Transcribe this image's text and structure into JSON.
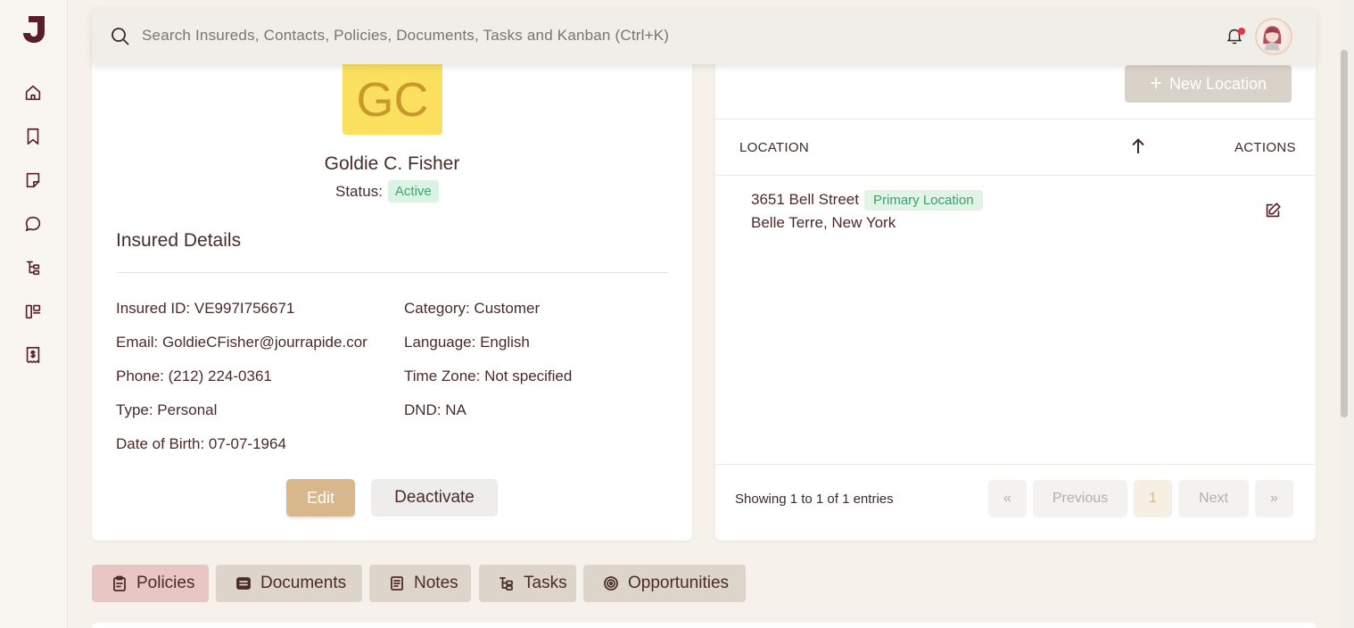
{
  "search": {
    "placeholder": "Search Insureds, Contacts, Policies, Documents, Tasks and Kanban (Ctrl+K)"
  },
  "sidebar": {
    "items": [
      {
        "name": "home-icon"
      },
      {
        "name": "bookmark-icon"
      },
      {
        "name": "note-icon"
      },
      {
        "name": "chat-icon"
      },
      {
        "name": "tasks-icon"
      },
      {
        "name": "kanban-icon"
      },
      {
        "name": "receipt-icon"
      }
    ]
  },
  "insured": {
    "initials": "GC",
    "name": "Goldie C. Fisher",
    "status_label": "Status:",
    "status": "Active",
    "section_title": "Insured Details",
    "details_left": [
      "Insured ID: VE997I756671",
      "Email: GoldieCFisher@jourrapide.cor",
      "Phone: (212) 224-0361",
      "Type: Personal",
      "Date of Birth: 07-07-1964"
    ],
    "details_right": [
      "Category: Customer",
      "Language: English",
      "Time Zone: Not specified",
      "DND: NA"
    ],
    "edit_label": "Edit",
    "deactivate_label": "Deactivate"
  },
  "locations": {
    "new_label": "New Location",
    "col_location": "LOCATION",
    "col_actions": "ACTIONS",
    "rows": [
      {
        "street": "3651 Bell Street",
        "badge": "Primary Location",
        "city": "Belle Terre, New York"
      }
    ],
    "showing": "Showing 1 to 1 of 1 entries",
    "first": "«",
    "previous": "Previous",
    "page": "1",
    "next": "Next",
    "last": "»"
  },
  "tabs": [
    {
      "label": "Policies",
      "active": true
    },
    {
      "label": "Documents",
      "active": false
    },
    {
      "label": "Notes",
      "active": false
    },
    {
      "label": "Tasks",
      "active": false
    },
    {
      "label": "Opportunities",
      "active": false
    }
  ],
  "colors": {
    "brand": "#5a1f24",
    "accent_gold": "#d9b78d",
    "avatar_yellow": "#fbe05f",
    "active_tab": "#e8c6c4",
    "status_green": "#3aa96a"
  }
}
